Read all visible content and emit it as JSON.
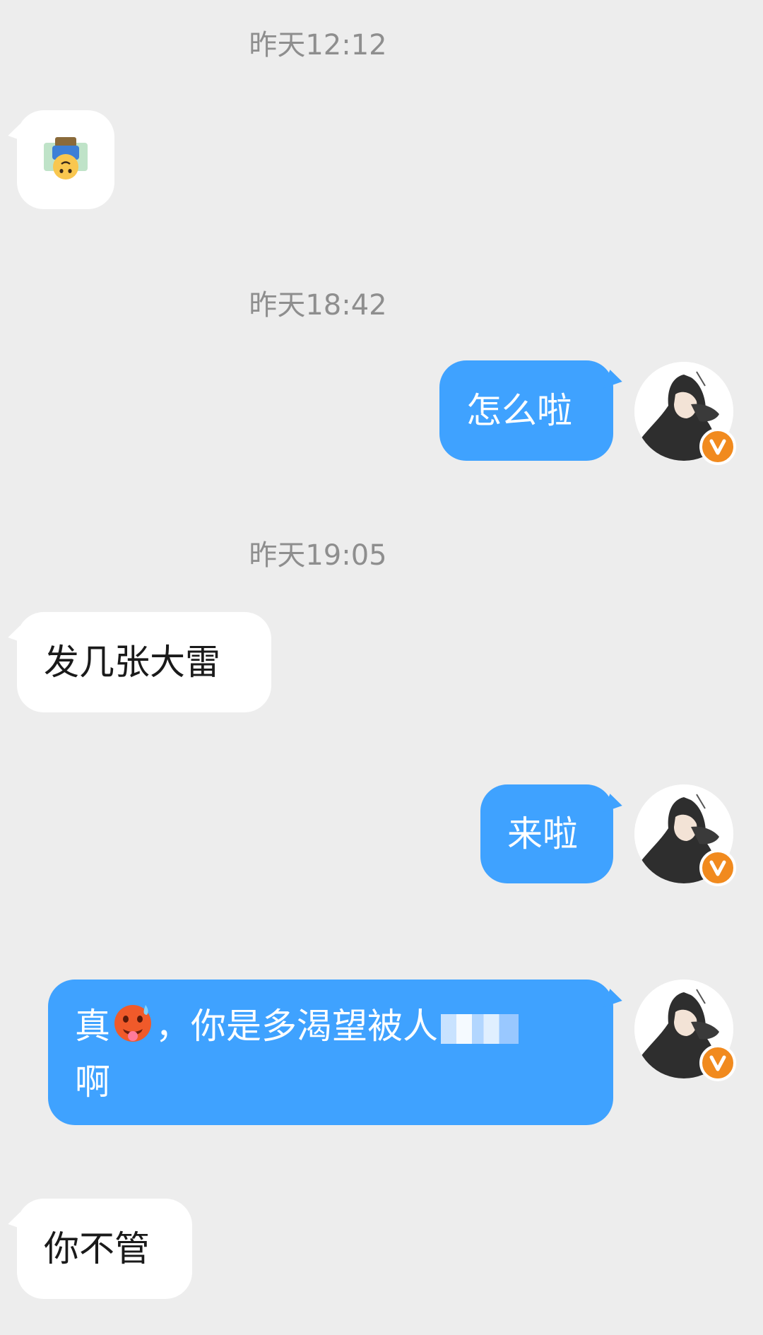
{
  "messages": {
    "ts1": "昨天12:12",
    "ts2": "昨天18:42",
    "ts3": "昨天19:05",
    "msg_out1": "怎么啦",
    "msg_in2": "发几张大雷",
    "msg_out2": "来啦",
    "msg_out3_part1": "真",
    "msg_out3_part2": "，你是多渴望被人",
    "msg_out3_part3": "啊",
    "msg_in3": "你不管"
  },
  "icons": {
    "sticker": "upside-down-face-sticker-icon",
    "hot_face": "hot-face-emoji-icon",
    "verified": "verified-v-badge-icon"
  },
  "colors": {
    "background": "#ededed",
    "incoming_bubble": "#ffffff",
    "outgoing_bubble": "#3fa2ff",
    "badge": "#f18a1e",
    "timestamp": "#8e8e8e"
  }
}
